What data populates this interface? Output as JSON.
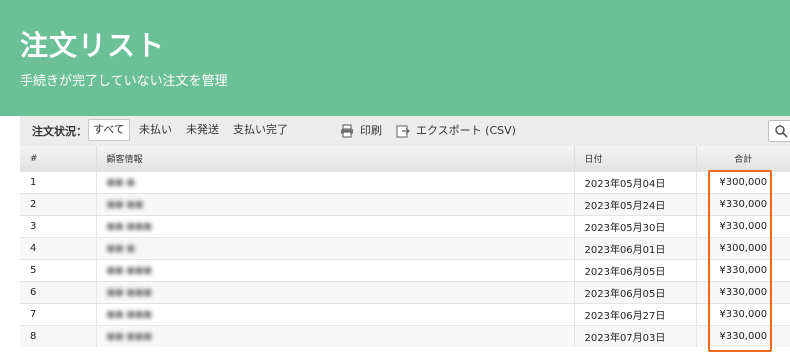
{
  "header": {
    "title": "注文リスト",
    "subtitle": "手続きが完了していない注文を管理"
  },
  "toolbar": {
    "status_label": "注文状況：",
    "filters": [
      "すべて",
      "未払い",
      "未発送",
      "支払い完了"
    ],
    "active_filter": "すべて",
    "print_label": "印刷",
    "export_label": "エクスポート (CSV)"
  },
  "table": {
    "columns": [
      "#",
      "顧客情報",
      "日付",
      "合計"
    ],
    "rows": [
      {
        "num": "1",
        "customer": "■■ ■",
        "date": "2023年05月04日",
        "total": "¥300,000"
      },
      {
        "num": "2",
        "customer": "■■ ■■",
        "date": "2023年05月24日",
        "total": "¥330,000"
      },
      {
        "num": "3",
        "customer": "■■ ■■■",
        "date": "2023年05月30日",
        "total": "¥330,000"
      },
      {
        "num": "4",
        "customer": "■■ ■",
        "date": "2023年06月01日",
        "total": "¥300,000"
      },
      {
        "num": "5",
        "customer": "■■ ■■■",
        "date": "2023年06月05日",
        "total": "¥330,000"
      },
      {
        "num": "6",
        "customer": "■■ ■■■",
        "date": "2023年06月05日",
        "total": "¥330,000"
      },
      {
        "num": "7",
        "customer": "■■ ■■■",
        "date": "2023年06月27日",
        "total": "¥330,000"
      },
      {
        "num": "8",
        "customer": "■■ ■■■",
        "date": "2023年07月03日",
        "total": "¥330,000"
      }
    ]
  },
  "colors": {
    "header_bg": "#6cc096",
    "highlight": "#ee6a1f"
  },
  "icons": {
    "print": "printer-icon",
    "export": "export-icon",
    "search": "search-icon"
  }
}
